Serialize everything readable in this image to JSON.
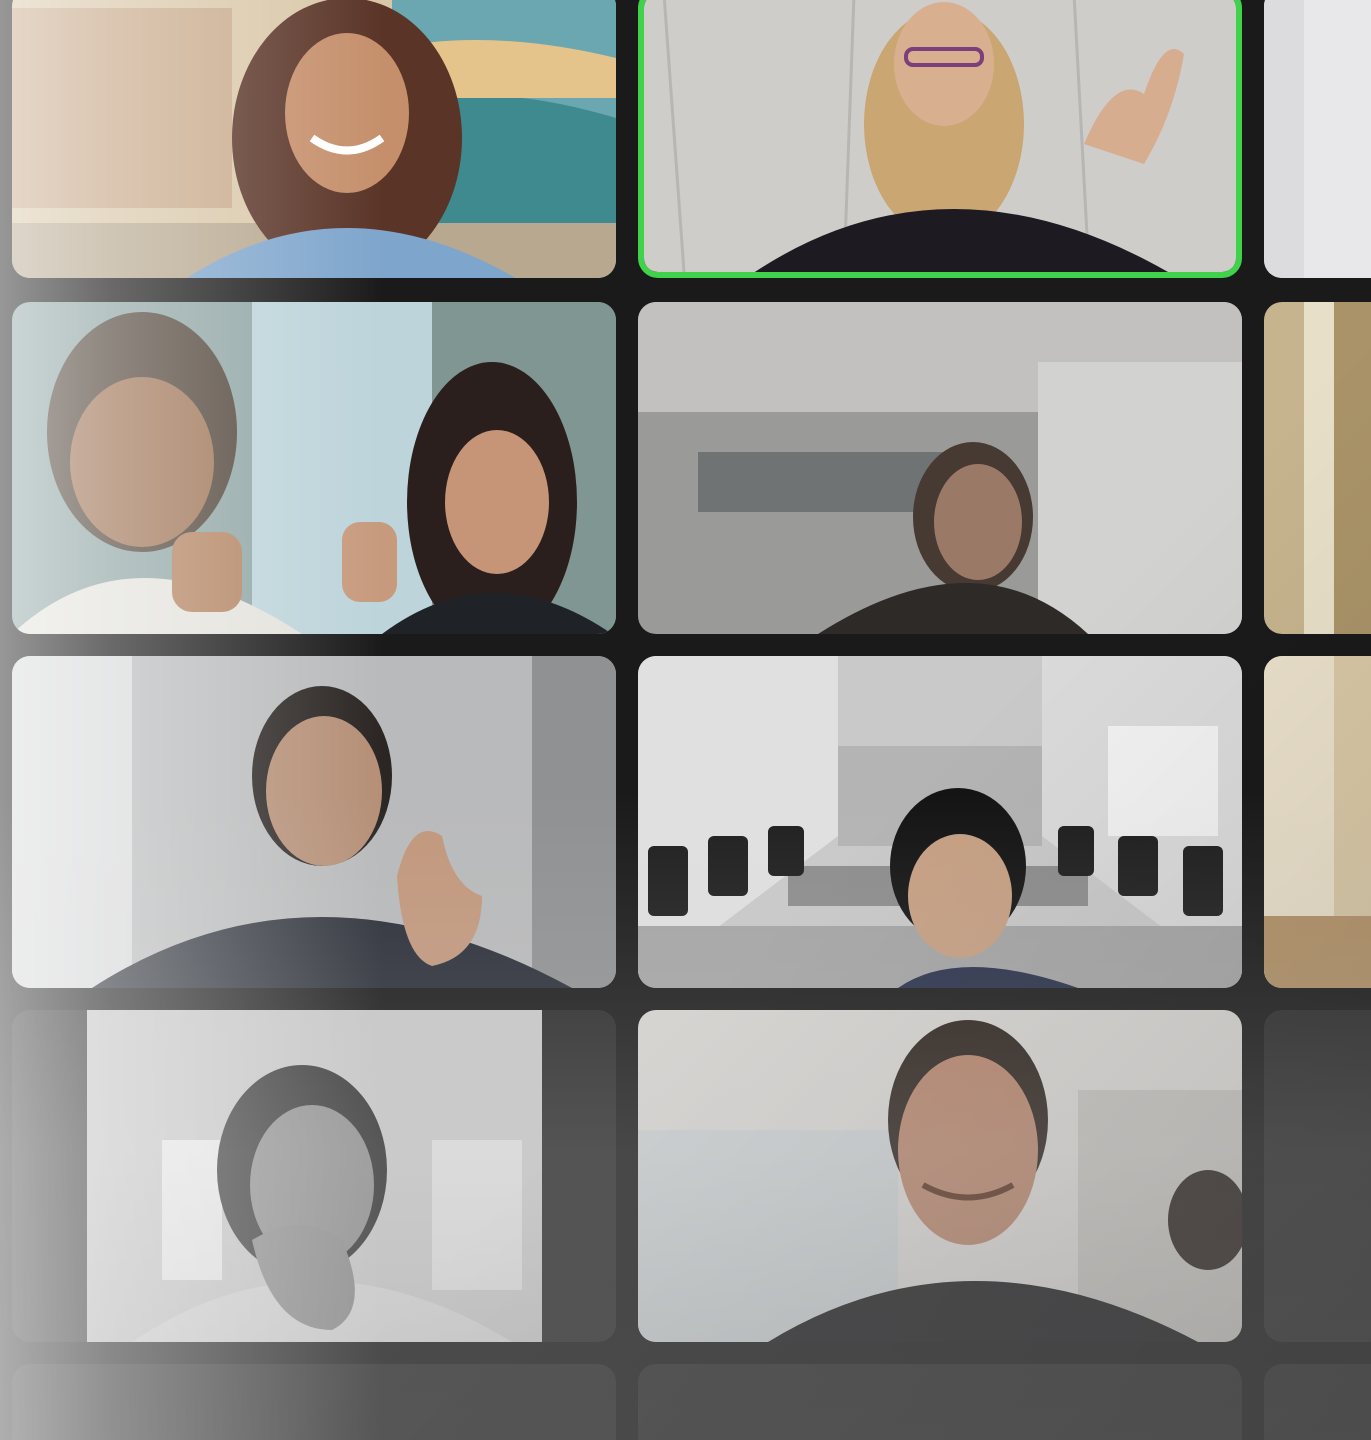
{
  "gallery": {
    "accent_color": "#3fd24a",
    "background_color": "#1a1a1a",
    "tiles": [
      {
        "id": "tile-1",
        "kind": "video"
      },
      {
        "id": "tile-2",
        "kind": "video",
        "active_speaker": true
      },
      {
        "id": "tile-3",
        "kind": "video"
      },
      {
        "id": "tile-4",
        "kind": "video"
      },
      {
        "id": "tile-5",
        "kind": "video"
      },
      {
        "id": "tile-6",
        "kind": "video"
      },
      {
        "id": "tile-7",
        "kind": "video"
      },
      {
        "id": "tile-8",
        "kind": "video"
      },
      {
        "id": "tile-9",
        "kind": "video"
      },
      {
        "id": "tile-10",
        "kind": "video"
      },
      {
        "id": "tile-11",
        "kind": "video"
      },
      {
        "id": "tile-12",
        "kind": "video"
      },
      {
        "id": "tile-13",
        "kind": "empty"
      },
      {
        "id": "tile-14",
        "kind": "empty"
      },
      {
        "id": "tile-15",
        "kind": "empty"
      }
    ]
  }
}
